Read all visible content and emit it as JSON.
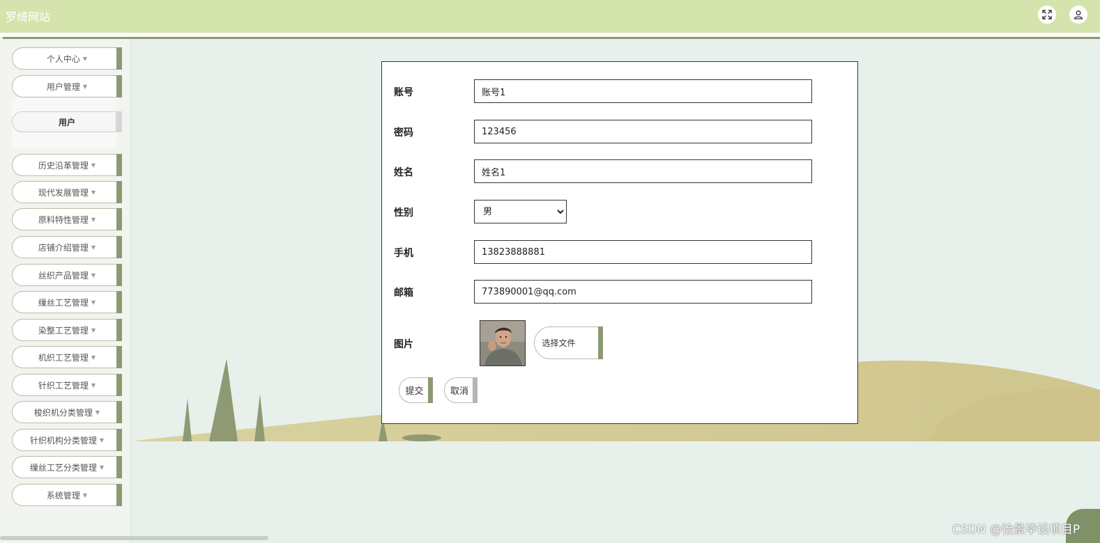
{
  "header": {
    "title": "罗绮网站"
  },
  "sidebar": {
    "items": [
      {
        "label": "个人中心"
      },
      {
        "label": "用户管理"
      },
      {
        "label": "历史沿革管理"
      },
      {
        "label": "现代发展管理"
      },
      {
        "label": "原料特性管理"
      },
      {
        "label": "店铺介绍管理"
      },
      {
        "label": "丝织产品管理"
      },
      {
        "label": "缫丝工艺管理"
      },
      {
        "label": "染整工艺管理"
      },
      {
        "label": "机织工艺管理"
      },
      {
        "label": "针织工艺管理"
      },
      {
        "label": "梭织机分类管理"
      },
      {
        "label": "针织机构分类管理"
      },
      {
        "label": "缫丝工艺分类管理"
      },
      {
        "label": "系统管理"
      }
    ],
    "sub_item": "用户"
  },
  "form": {
    "account": {
      "label": "账号",
      "value": "账号1"
    },
    "password": {
      "label": "密码",
      "value": "123456"
    },
    "name": {
      "label": "姓名",
      "value": "姓名1"
    },
    "gender": {
      "label": "性别",
      "value": "男"
    },
    "phone": {
      "label": "手机",
      "value": "13823888881"
    },
    "email": {
      "label": "邮箱",
      "value": "773890001@qq.com"
    },
    "photo": {
      "label": "图片",
      "choose_file": "选择文件"
    },
    "submit": "提交",
    "cancel": "取消"
  },
  "watermark": "CSDN @怡景毕设项目P",
  "colors": {
    "header": "#d5e4ad",
    "accent": "#8c9a72",
    "background": "#e8f0ec"
  }
}
